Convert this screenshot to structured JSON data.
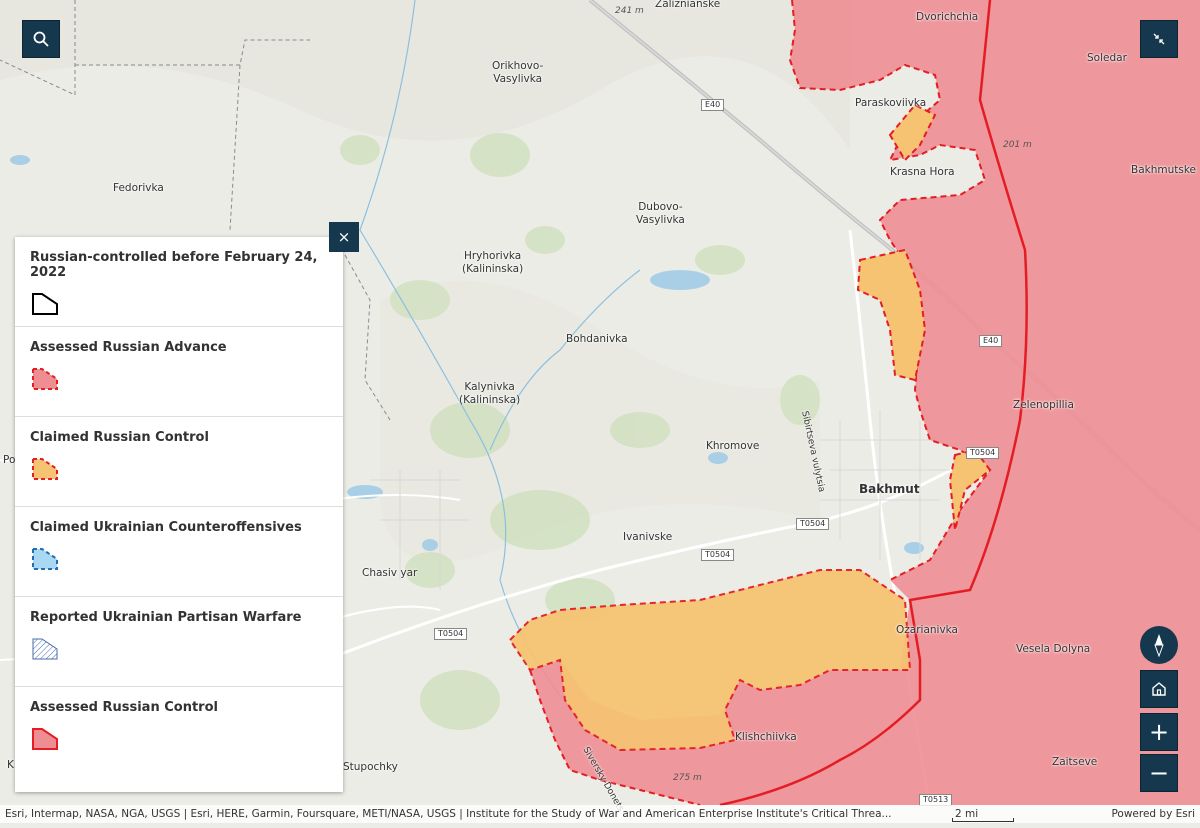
{
  "colors": {
    "assessed_control_fill": "#ee8e93",
    "claimed_control_fill": "#f6c373",
    "control_border": "#e41d24",
    "button_bg": "#15384f"
  },
  "map": {
    "places": {
      "zaliznianske": "Zaliznianske",
      "dvorichchia": "Dvorichchia",
      "soledar": "Soledar",
      "orikhovo": "Orikhovo-\nVasylivka",
      "paraskoviivka": "Paraskoviivka",
      "krasna_hora": "Krasna Hora",
      "bakhmutske": "Bakhmutske",
      "fedorivka": "Fedorivka",
      "dubovo": "Dubovo-\nVasylivka",
      "hryhorivka": "Hryhorivka\n(Kalininska)",
      "bohdanivka": "Bohdanivka",
      "kalynivka": "Kalynivka\n(Kalininska)",
      "zelenopillia": "Zelenopillia",
      "khromove": "Khromove",
      "bakhmut": "Bakhmut",
      "ivanivske": "Ivanivske",
      "chasiv_yar": "Chasiv yar",
      "ozarianivka": "Ozarianivka",
      "vesela_dolyna": "Vesela Dolyna",
      "klishchiivka": "Klishchiivka",
      "zaitseve": "Zaitseve",
      "stupochky": "Stupochky",
      "po": "Po",
      "k": "K",
      "sibirtseva": "Sibirtseva vulytsia",
      "siversky": "Siversky-Donets"
    },
    "roads": [
      "E40",
      "E40",
      "T0504",
      "T0504",
      "T0504",
      "T0504",
      "T0513"
    ],
    "elevations": [
      "241 m",
      "201 m",
      "275 m"
    ]
  },
  "controls": {
    "search_icon": "search-icon",
    "collapse_icon": "collapse-arrows-icon",
    "compass_icon": "compass-icon",
    "home_icon": "home-icon",
    "zoom_in": "+",
    "zoom_out": "−"
  },
  "legend": {
    "close_label": "×",
    "items": [
      {
        "label": "Russian-controlled before February 24, 2022"
      },
      {
        "label": "Assessed Russian Advance"
      },
      {
        "label": "Claimed Russian Control"
      },
      {
        "label": "Claimed Ukrainian Counteroffensives"
      },
      {
        "label": "Reported Ukrainian Partisan Warfare"
      },
      {
        "label": "Assessed Russian Control"
      }
    ]
  },
  "attribution": {
    "text": "Esri, Intermap, NASA, NGA, USGS | Esri, HERE, Garmin, Foursquare, METI/NASA, USGS | Institute for the Study of War and American Enterprise Institute's Critical Threa...",
    "scale": "2 mi",
    "powered_by": "Powered by Esri"
  }
}
